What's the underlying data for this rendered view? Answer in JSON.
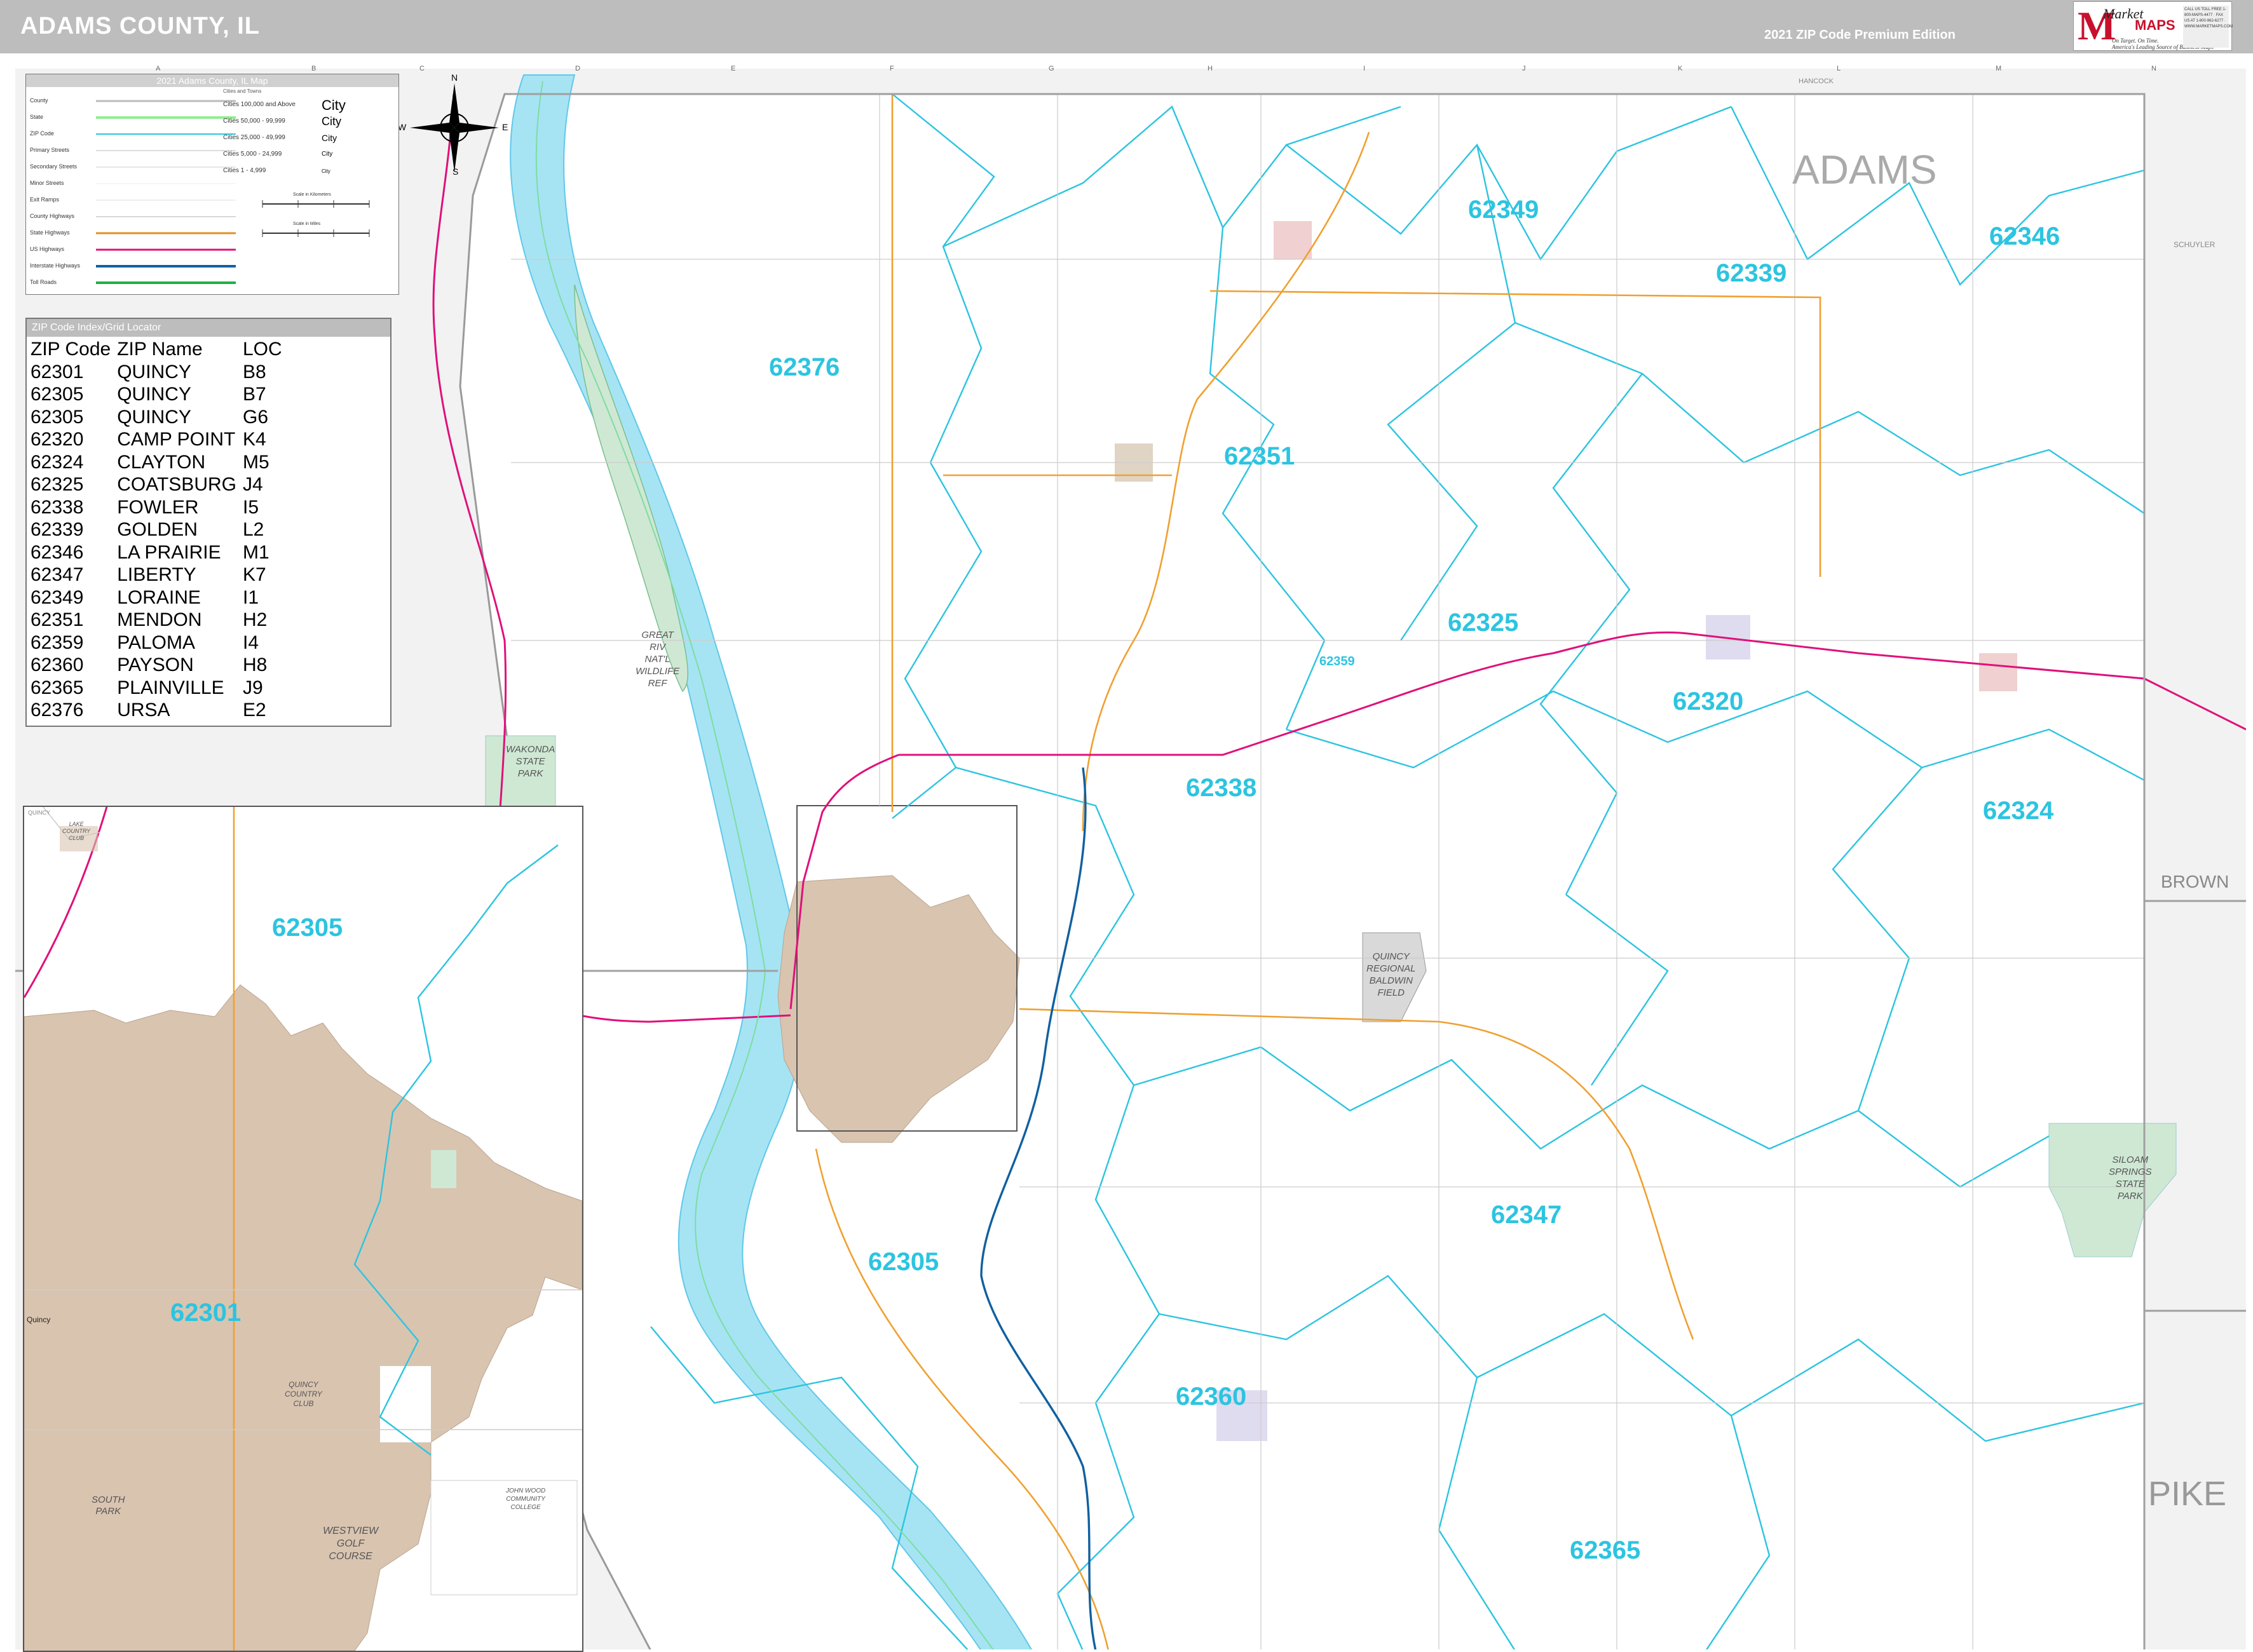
{
  "header": {
    "title": "ADAMS COUNTY, IL",
    "edition": "2021 ZIP Code Premium Edition",
    "logo": {
      "brand_top": "Market",
      "brand_bottom": "MAPS",
      "tagline_1": "On Target. On Time.",
      "tagline_2": "America's Leading Source of Business Maps",
      "contact": "CALL US TOLL FREE 1-800-MAPS-4477 · FAX US AT 1-800-962-6277 · WWW.MARKETMAPS.COM"
    }
  },
  "legend": {
    "title": "2021 Adams County, IL Map",
    "rows": [
      "County",
      "State",
      "ZIP Code",
      "Primary Streets",
      "Secondary Streets",
      "Minor Streets",
      "Exit Ramps",
      "County Highways",
      "State Highways",
      "US Highways",
      "Interstate Highways",
      "Toll Roads"
    ],
    "cities_heading": "Cities and Towns",
    "city_classes": [
      {
        "label": "Cities 100,000 and Above",
        "sample": "City"
      },
      {
        "label": "Cities 50,000 - 99,999",
        "sample": "City"
      },
      {
        "label": "Cities 25,000 - 49,999",
        "sample": "City"
      },
      {
        "label": "Cities 5,000 - 24,999",
        "sample": "City"
      },
      {
        "label": "Cities 1 - 4,999",
        "sample": "City"
      }
    ],
    "scale_km": "Scale in Kilometers",
    "scale_mi": "Scale in Miles",
    "colors": {
      "county": "#bbbbbb",
      "state": "#90ee90",
      "zip": "#2cc4e0",
      "county_hwy": "#f0a030",
      "state_hwy": "#e09020",
      "us_hwy": "#e0107a",
      "interstate": "#1060a0",
      "toll": "#20b040"
    }
  },
  "zip_index": {
    "title": "ZIP Code Index/Grid Locator",
    "headers": [
      "ZIP Code",
      "ZIP Name",
      "LOC"
    ],
    "rows": [
      [
        "62301",
        "QUINCY",
        "B8"
      ],
      [
        "62305",
        "QUINCY",
        "B7"
      ],
      [
        "62305",
        "QUINCY",
        "G6"
      ],
      [
        "62320",
        "CAMP POINT",
        "K4"
      ],
      [
        "62324",
        "CLAYTON",
        "M5"
      ],
      [
        "62325",
        "COATSBURG",
        "J4"
      ],
      [
        "62338",
        "FOWLER",
        "I5"
      ],
      [
        "62339",
        "GOLDEN",
        "L2"
      ],
      [
        "62346",
        "LA PRAIRIE",
        "M1"
      ],
      [
        "62347",
        "LIBERTY",
        "K7"
      ],
      [
        "62349",
        "LORAINE",
        "I1"
      ],
      [
        "62351",
        "MENDON",
        "H2"
      ],
      [
        "62359",
        "PALOMA",
        "I4"
      ],
      [
        "62360",
        "PAYSON",
        "H8"
      ],
      [
        "62365",
        "PLAINVILLE",
        "J9"
      ],
      [
        "62376",
        "URSA",
        "E2"
      ]
    ]
  },
  "map": {
    "county_label": "ADAMS",
    "adjacent": {
      "hancock": "HANCOCK",
      "schuyler": "SCHUYLER",
      "brown": "BROWN",
      "pike": "PIKE"
    },
    "zip_labels": [
      {
        "id": "z62349",
        "text": "62349"
      },
      {
        "id": "z62346",
        "text": "62346"
      },
      {
        "id": "z62339",
        "text": "62339"
      },
      {
        "id": "z62376",
        "text": "62376"
      },
      {
        "id": "z62351",
        "text": "62351"
      },
      {
        "id": "z62325",
        "text": "62325"
      },
      {
        "id": "z62359",
        "text": "62359"
      },
      {
        "id": "z62320",
        "text": "62320"
      },
      {
        "id": "z62338",
        "text": "62338"
      },
      {
        "id": "z62324",
        "text": "62324"
      },
      {
        "id": "z62347",
        "text": "62347"
      },
      {
        "id": "z62305",
        "text": "62305"
      },
      {
        "id": "z62360",
        "text": "62360"
      },
      {
        "id": "z62365",
        "text": "62365"
      }
    ],
    "parks": {
      "great_river": "GREAT\nRIV\nNAT'L\nWILDLIFE\nREF",
      "wakonda": "WAKONDA\nSTATE\nPARK",
      "siloam": "SILOAM\nSPRINGS\nSTATE\nPARK",
      "airport": "QUINCY\nREGIONAL\nBALDWIN\nFIELD"
    },
    "grid_columns": [
      "A",
      "B",
      "C",
      "D",
      "E",
      "F",
      "G",
      "H",
      "I",
      "J",
      "K",
      "L",
      "M",
      "N"
    ],
    "compass": {
      "n": "N",
      "e": "E",
      "s": "S",
      "w": "W"
    }
  },
  "inset": {
    "label": "QUINCY",
    "zip_labels": [
      {
        "id": "i62305",
        "text": "62305"
      },
      {
        "id": "i62301",
        "text": "62301"
      }
    ],
    "places": {
      "lake_cc": "LAKE\nCOUNTRY\nCLUB",
      "quincy_cc": "QUINCY\nCOUNTRY\nCLUB",
      "westview": "WESTVIEW\nGOLF\nCOURSE",
      "south_park": "SOUTH\nPARK",
      "john_wood": "JOHN WOOD\nCOMMUNITY\nCOLLEGE",
      "quincy_town": "Quincy"
    }
  }
}
